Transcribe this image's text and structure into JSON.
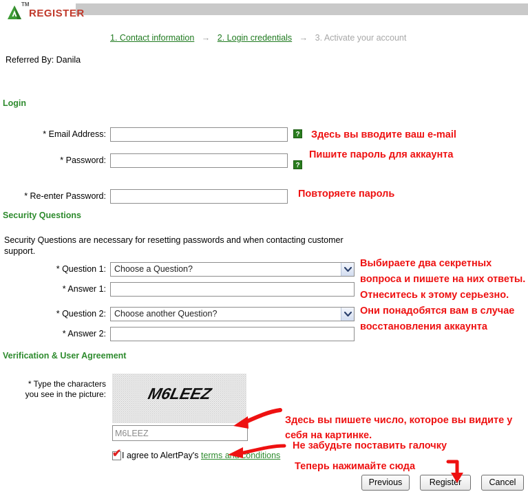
{
  "header": {
    "logo_tm": "TM",
    "title": "REGISTER"
  },
  "steps": {
    "step1": "1. Contact information",
    "step2": "2. Login credentials",
    "step3": "3. Activate your account",
    "arrow": "→"
  },
  "referred_by": "Referred By: Danila",
  "sections": {
    "login": "Login",
    "security": "Security Questions",
    "verification": "Verification & User Agreement"
  },
  "security_description": "Security Questions are necessary for resetting passwords and when contacting customer support.",
  "labels": {
    "email": "* Email Address:",
    "password": "* Password:",
    "repassword": "* Re-enter Password:",
    "question1": "* Question 1:",
    "answer1": "* Answer 1:",
    "question2": "* Question 2:",
    "answer2": "* Answer 2:",
    "captcha_line1": "* Type the characters",
    "captcha_line2": "you see in the picture:"
  },
  "fields": {
    "email_value": "",
    "password_value": "",
    "repassword_value": "",
    "answer1_value": "",
    "answer2_value": "",
    "captcha_value": "M6LEEZ",
    "question1_selected": "Choose a Question?",
    "question2_selected": "Choose another Question?"
  },
  "help_icon_label": "?",
  "captcha_image_text": "M6LEEZ",
  "agreement": {
    "checked": true,
    "check_glyph": "✔",
    "text_before": "I agree to AlertPay's",
    "link": "terms and conditions"
  },
  "buttons": {
    "previous": "Previous",
    "register": "Register",
    "cancel": "Cancel"
  },
  "annotations": {
    "email": "Здесь вы вводите ваш e-mail",
    "password": "Пишите пароль для аккаунта",
    "repassword": "Повторяете пароль",
    "security": "Выбираете два секретных вопроса и пишете на них ответы. Отнеситесь к этому серьезно. Они понадобятся вам в случае восстановления аккаунта",
    "captcha": "Здесь вы пишете число, которое вы видите у себя на картинке.",
    "checkbox": "Не забудьте поставить галочку",
    "register": "Теперь нажимайте сюда"
  },
  "colors": {
    "accent_green": "#2e8b2e",
    "logo_red": "#c0392b",
    "annotation_red": "#ee1111",
    "header_gray": "#c9c9c9"
  }
}
